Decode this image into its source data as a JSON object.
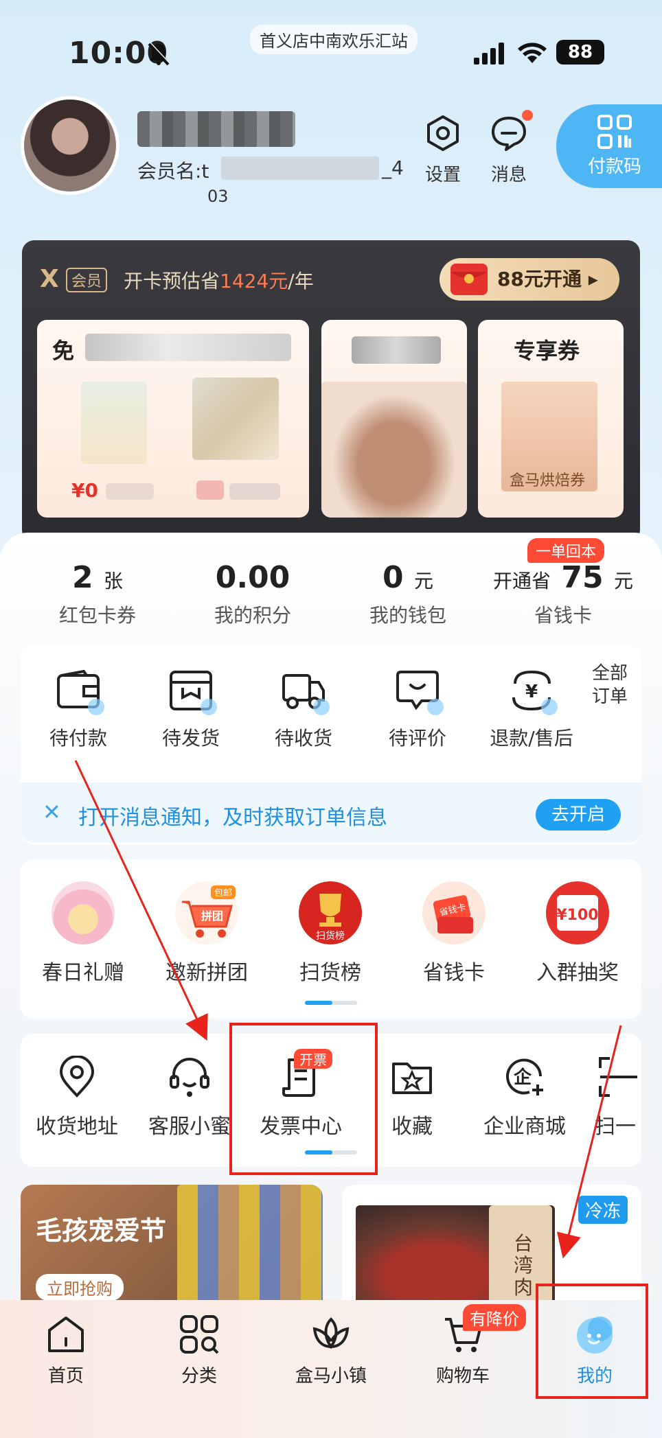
{
  "status_bar": {
    "time": "10:00",
    "store": "首义店中南欢乐汇站",
    "battery": "88"
  },
  "profile": {
    "member_label": "会员名:t",
    "member_suffix": "_4",
    "member_line2": "03",
    "settings": "设置",
    "messages": "消息",
    "paycode": "付款码"
  },
  "vip": {
    "tag": "会员",
    "estimate_prefix": "开卡预估省",
    "estimate_value": "1424元",
    "estimate_suffix": "/年",
    "open_button": "88元开通",
    "tile1_price": "¥0",
    "tile3_title": "专享券",
    "tile1_title": "免",
    "tile3_sub": "盒马烘焙券",
    "tile2_text": "",
    "tile1_sub": ""
  },
  "stats": {
    "coupons_num": "2",
    "coupons_unit": "张",
    "coupons_label": "红包卡券",
    "points_num": "0.00",
    "points_label": "我的积分",
    "wallet_num": "0",
    "wallet_unit": "元",
    "wallet_label": "我的钱包",
    "saver_prefix": "开通省",
    "saver_num": "75",
    "saver_unit": "元",
    "saver_label": "省钱卡",
    "saver_badge": "一单回本"
  },
  "orders": {
    "items": [
      "待付款",
      "待发货",
      "待收货",
      "待评价",
      "退款/售后"
    ],
    "all": "全部订单"
  },
  "notify": {
    "text": "打开消息通知，及时获取订单信息",
    "button": "去开启"
  },
  "promos": [
    "春日礼赠",
    "邀新拼团",
    "扫货榜",
    "省钱卡",
    "入群抽奖"
  ],
  "promo_badges": {
    "pintuan": "包邮",
    "pintuan_icon": "拼团",
    "saohuo_icon": "扫货榜",
    "saver_icon": "省钱卡",
    "lottery_icon": "¥100"
  },
  "tools": {
    "items": [
      "收货地址",
      "客服小蜜",
      "发票中心",
      "收藏",
      "企业商城",
      "扫一"
    ],
    "invoice_badge": "开票"
  },
  "feed": {
    "left_title": "毛孩宠爱节",
    "left_button": "立即抢购",
    "right_tag": "冷冻",
    "right_text": "台湾肉风"
  },
  "tabbar": {
    "items": [
      "首页",
      "分类",
      "盒马小镇",
      "购物车",
      "我的"
    ],
    "cart_badge": "有降价"
  },
  "colors": {
    "accent_blue": "#1fa0f2",
    "badge_red": "#ff4b36",
    "annotation_red": "#e8231c",
    "vip_gold": "#e9d9be"
  }
}
